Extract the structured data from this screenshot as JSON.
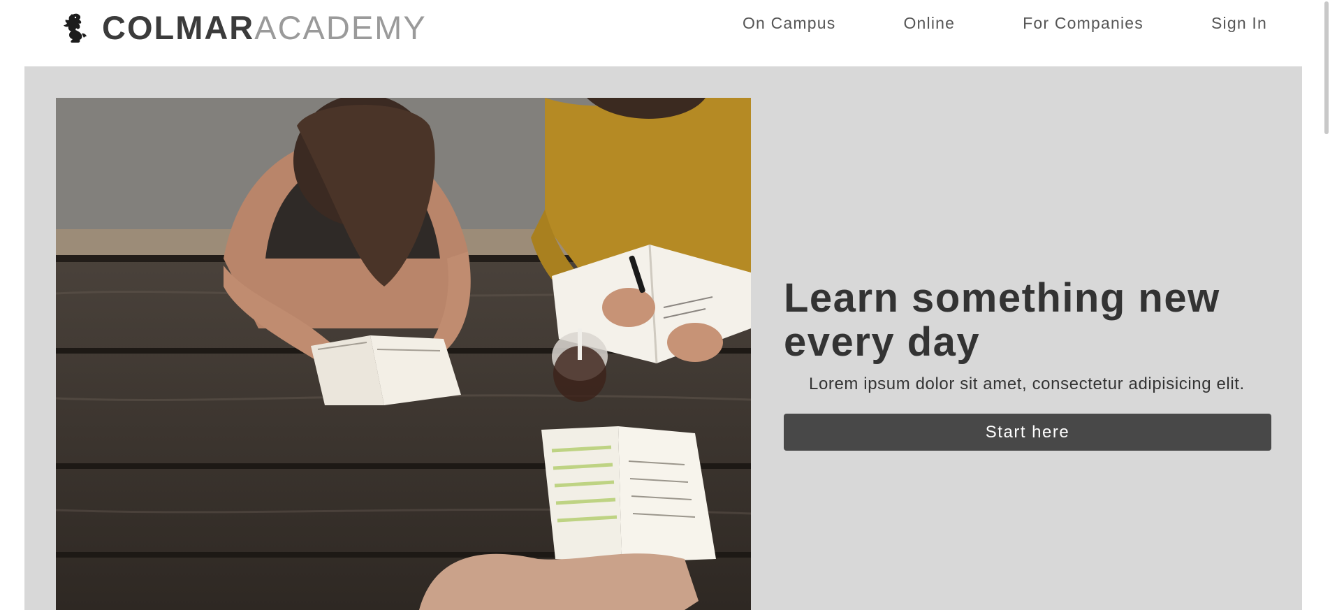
{
  "brand": {
    "name_bold": "COLMAR",
    "name_light": "ACADEMY",
    "logo_icon": "lion-rampant-icon"
  },
  "nav": {
    "items": [
      {
        "label": "On Campus"
      },
      {
        "label": "Online"
      },
      {
        "label": "For Companies"
      },
      {
        "label": "Sign In"
      }
    ]
  },
  "hero": {
    "image_alt": "Students studying at a wooden picnic table",
    "headline": "Learn something new every day",
    "subline": "Lorem ipsum dolor sit amet, consectetur adipisicing elit.",
    "cta_label": "Start here"
  },
  "colors": {
    "hero_bg": "#d8d8d8",
    "button_bg": "#484848",
    "brand_dark": "#3b3b3b",
    "brand_light": "#9a9a9a"
  }
}
